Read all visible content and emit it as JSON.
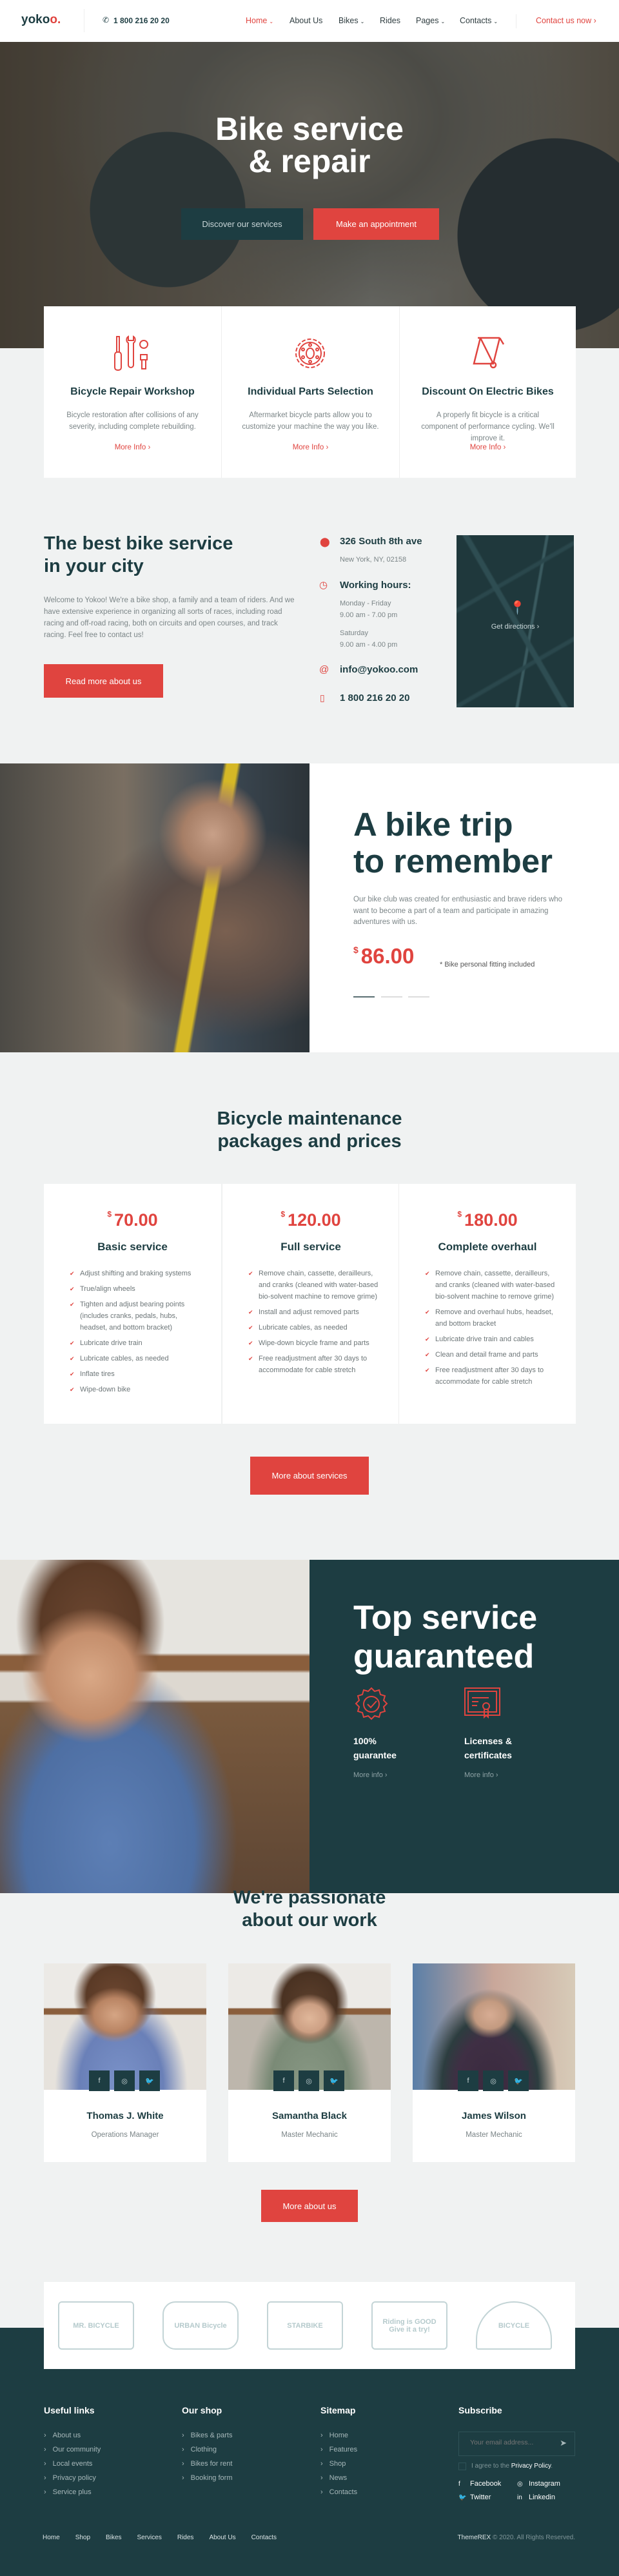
{
  "colors": {
    "accent": "#e0443f",
    "dark": "#1d3d42",
    "background": "#f0f2f2"
  },
  "header": {
    "logo_text": "yoko",
    "logo_accent": "o.",
    "phone": "1 800 216 20 20",
    "nav": [
      {
        "label": "Home",
        "dropdown": true,
        "active": true
      },
      {
        "label": "About Us"
      },
      {
        "label": "Bikes",
        "dropdown": true
      },
      {
        "label": "Rides"
      },
      {
        "label": "Pages",
        "dropdown": true
      },
      {
        "label": "Contacts",
        "dropdown": true
      }
    ],
    "cta": "Contact us now"
  },
  "hero": {
    "title_line1": "Bike service",
    "title_line2": "& repair",
    "btn_secondary": "Discover our services",
    "btn_primary": "Make an appointment"
  },
  "features": [
    {
      "icon": "tools-icon",
      "title": "Bicycle Repair Workshop",
      "desc": "Bicycle restoration after collisions of any severity, including complete rebuilding.",
      "link": "More Info"
    },
    {
      "icon": "gear-icon",
      "title": "Individual Parts Selection",
      "desc": "Aftermarket bicycle parts allow you to customize your machine the way you like.",
      "link": "More Info"
    },
    {
      "icon": "bike-frame-icon",
      "title": "Discount On Electric Bikes",
      "desc": "A properly fit bicycle is a critical component of performance cycling. We'll improve it.",
      "link": "More Info"
    }
  ],
  "about": {
    "title_line1": "The best bike service",
    "title_line2": "in your city",
    "text": "Welcome to Yokoo! We're a bike shop, a family and a team of riders. And we have extensive experience in organizing all sorts of races, including road racing and off-road racing, both on circuits and open courses, and track racing. Feel free to contact us!",
    "button": "Read more about us",
    "address": "326 South 8th ave",
    "city": "New York, NY, 02158",
    "hours_title": "Working hours:",
    "weekdays": "Monday - Friday",
    "weekdays_hours": "9.00 am - 7.00 pm",
    "saturday": "Saturday",
    "saturday_hours": "9.00 am - 4.00 pm",
    "email": "info@yokoo.com",
    "phone": "1 800 216 20 20",
    "map_link": "Get directions"
  },
  "trip": {
    "title_line1": "A bike trip",
    "title_line2": "to remember",
    "text": "Our bike club was created for enthusiastic and brave riders who want to become a part of a team and participate in amazing adventures with us.",
    "currency": "$",
    "price": "86.00",
    "note": "* Bike personal fitting included",
    "slides_total": 3,
    "slide_active": 1
  },
  "pricing": {
    "title_line1": "Bicycle maintenance",
    "title_line2": "packages and prices",
    "plans": [
      {
        "currency": "$",
        "price": "70.00",
        "name": "Basic service",
        "items": [
          "Adjust shifting and braking systems",
          "True/align wheels",
          "Tighten and adjust bearing points (includes cranks, pedals, hubs, headset, and bottom bracket)",
          "Lubricate drive train",
          "Lubricate cables, as needed",
          "Inflate tires",
          "Wipe-down bike"
        ]
      },
      {
        "currency": "$",
        "price": "120.00",
        "name": "Full service",
        "items": [
          "Remove chain, cassette, derailleurs, and cranks (cleaned with water-based bio-solvent machine to remove grime)",
          "Install and adjust removed parts",
          "Lubricate cables, as needed",
          "Wipe-down bicycle frame and parts",
          "Free readjustment after 30 days to accommodate for cable stretch"
        ]
      },
      {
        "currency": "$",
        "price": "180.00",
        "name": "Complete overhaul",
        "items": [
          "Remove chain, cassette, derailleurs, and cranks (cleaned with water-based bio-solvent machine to remove grime)",
          "Remove and overhaul hubs, headset, and bottom bracket",
          "Lubricate drive train and cables",
          "Clean and detail frame and parts",
          "Free readjustment after 30 days to accommodate for cable stretch"
        ]
      }
    ],
    "button": "More about services"
  },
  "guarantee": {
    "title_line1": "Top service",
    "title_line2": "guaranteed",
    "items": [
      {
        "icon": "badge-check-icon",
        "line1": "100%",
        "line2": "guarantee",
        "link": "More info"
      },
      {
        "icon": "certificate-icon",
        "line1": "Licenses &",
        "line2": "certificates",
        "link": "More info"
      }
    ]
  },
  "team": {
    "title_line1": "We're passionate",
    "title_line2": "about our work",
    "members": [
      {
        "name": "Thomas J. White",
        "role": "Operations Manager"
      },
      {
        "name": "Samantha Black",
        "role": "Master Mechanic"
      },
      {
        "name": "James Wilson",
        "role": "Master Mechanic"
      }
    ],
    "social": [
      "f",
      "◎",
      "🐦"
    ],
    "button": "More about us"
  },
  "partners": [
    "MR. BICYCLE",
    "URBAN Bicycle",
    "STARBIKE",
    "Riding is GOOD Give it a try!",
    "BICYCLE"
  ],
  "footer": {
    "columns": [
      {
        "title": "Useful links",
        "links": [
          "About us",
          "Our community",
          "Local events",
          "Privacy policy",
          "Service plus"
        ]
      },
      {
        "title": "Our shop",
        "links": [
          "Bikes & parts",
          "Clothing",
          "Bikes for rent",
          "Booking form"
        ]
      },
      {
        "title": "Sitemap",
        "links": [
          "Home",
          "Features",
          "Shop",
          "News",
          "Contacts"
        ]
      }
    ],
    "subscribe": {
      "title": "Subscribe",
      "placeholder": "Your email address...",
      "agree_prefix": "I agree to the ",
      "agree_link": "Privacy Policy",
      "agree_suffix": "."
    },
    "social": [
      {
        "icon": "facebook-icon",
        "glyph": "f",
        "label": "Facebook"
      },
      {
        "icon": "instagram-icon",
        "glyph": "◎",
        "label": "Instagram"
      },
      {
        "icon": "twitter-icon",
        "glyph": "🐦",
        "label": "Twitter"
      },
      {
        "icon": "linkedin-icon",
        "glyph": "in",
        "label": "Linkedin"
      }
    ],
    "bottom_links": [
      "Home",
      "Shop",
      "Bikes",
      "Services",
      "Rides",
      "About Us",
      "Contacts"
    ],
    "brand": "ThemeREX",
    "copyright": "© 2020. All Rights Reserved."
  }
}
